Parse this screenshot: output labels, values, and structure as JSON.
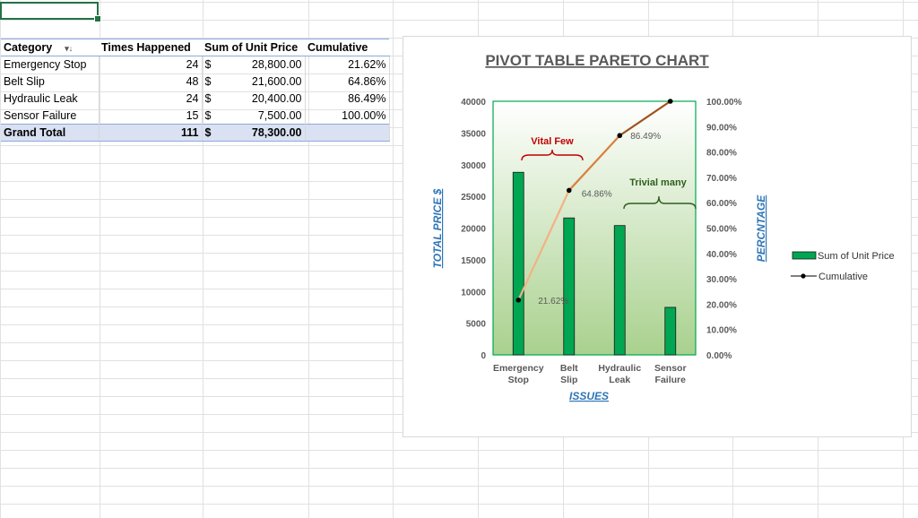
{
  "table": {
    "headers": [
      "Category",
      "Times Happened",
      "Sum of Unit Price",
      "Cumulative"
    ],
    "rows": [
      {
        "category": "Emergency Stop",
        "times": "24",
        "currency": "$",
        "price": "28,800.00",
        "cumulative": "21.62%"
      },
      {
        "category": "Belt Slip",
        "times": "48",
        "currency": "$",
        "price": "21,600.00",
        "cumulative": "64.86%"
      },
      {
        "category": "Hydraulic Leak",
        "times": "24",
        "currency": "$",
        "price": "20,400.00",
        "cumulative": "86.49%"
      },
      {
        "category": "Sensor Failure",
        "times": "15",
        "currency": "$",
        "price": "7,500.00",
        "cumulative": "100.00%"
      }
    ],
    "total": {
      "label": "Grand Total",
      "times": "111",
      "currency": "$",
      "price": "78,300.00"
    }
  },
  "chart_data": {
    "type": "bar",
    "title": "PIVOT TABLE PARETO CHART",
    "xlabel": "ISSUES",
    "ylabel": "TOTAL PRICE $",
    "y2label": "PERCNTAGE",
    "categories": [
      "Emergency Stop",
      "Belt Slip",
      "Hydraulic Leak",
      "Sensor Failure"
    ],
    "series": [
      {
        "name": "Sum of Unit Price",
        "kind": "bar",
        "axis": "left",
        "color": "#00a651",
        "values": [
          28800,
          21600,
          20400,
          7500
        ]
      },
      {
        "name": "Cumulative",
        "kind": "line",
        "axis": "right",
        "color": "#c0601a",
        "values": [
          21.62,
          64.86,
          86.49,
          100
        ]
      }
    ],
    "ylim": [
      0,
      40000
    ],
    "yticks": [
      "0",
      "5000",
      "10000",
      "15000",
      "20000",
      "25000",
      "30000",
      "35000",
      "40000"
    ],
    "y2lim": [
      0,
      100
    ],
    "y2ticks": [
      "0.00%",
      "10.00%",
      "20.00%",
      "30.00%",
      "40.00%",
      "50.00%",
      "60.00%",
      "70.00%",
      "80.00%",
      "90.00%",
      "100.00%"
    ],
    "point_labels": [
      "21.62%",
      "64.86%",
      "86.49%"
    ],
    "annotations": [
      {
        "text": "Vital Few",
        "color": "#c00000"
      },
      {
        "text": "Trivial many",
        "color": "#2e5e1e"
      }
    ],
    "legend_position": "right",
    "grid": false
  }
}
